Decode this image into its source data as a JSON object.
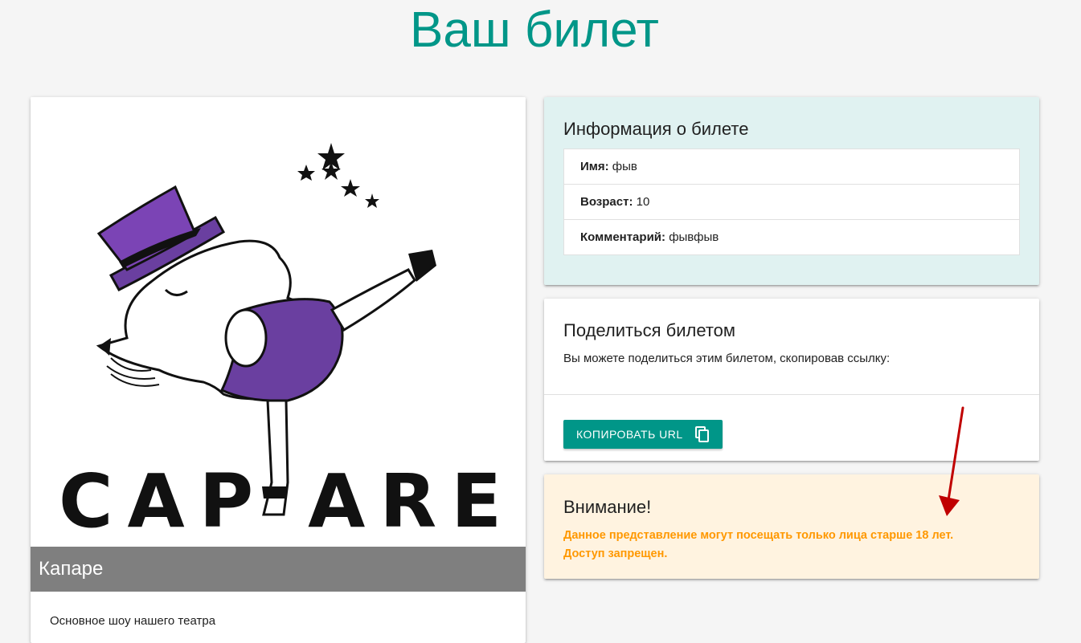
{
  "page": {
    "title": "Ваш билет"
  },
  "show": {
    "image_text": "CAPARE",
    "title": "Капаре",
    "description": "Основное шоу нашего театра"
  },
  "info": {
    "title": "Информация о билете",
    "items": [
      {
        "label": "Имя:",
        "value": "фыв"
      },
      {
        "label": "Возраст:",
        "value": "10"
      },
      {
        "label": "Комментарий:",
        "value": "фывфыв"
      }
    ]
  },
  "share": {
    "title": "Поделиться билетом",
    "text": "Вы можете поделиться этим билетом, скопировав ссылку:",
    "button_label": "КОПИРОВАТЬ URL",
    "button_icon": "copy-icon"
  },
  "warning": {
    "title": "Внимание!",
    "line1": "Данное представление могут посещать только лица старше 18 лет.",
    "line2": "Доступ запрещен."
  },
  "colors": {
    "accent": "#009688",
    "info_bg": "#e0f2f1",
    "warning_bg": "#fff3e0",
    "warning_text": "#ff9800",
    "annotation_arrow": "#c00000"
  }
}
